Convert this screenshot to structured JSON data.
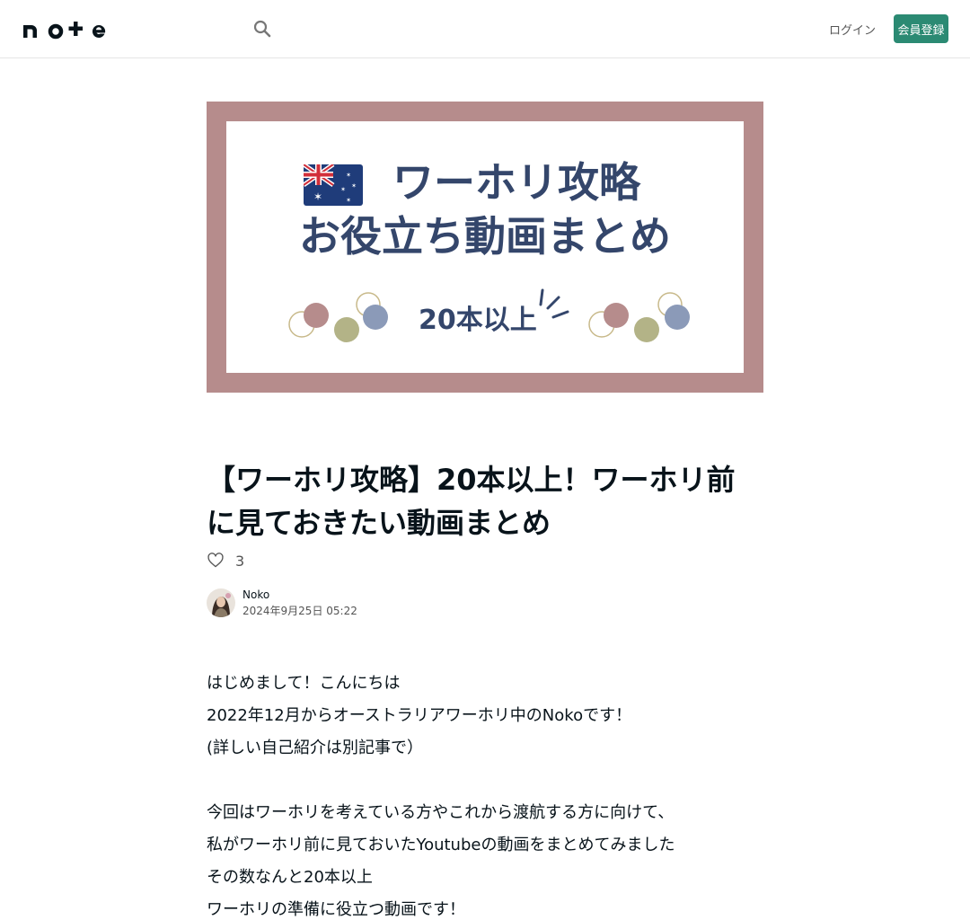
{
  "header": {
    "logo_text": "note",
    "login_label": "ログイン",
    "signup_label": "会員登録",
    "brand_color": "#2b8a73"
  },
  "hero": {
    "frame_color": "#b68c8c",
    "text_color": "#34466b",
    "line1": "ワーホリ攻略",
    "line2": "お役立ち動画まとめ",
    "count": "20本以上"
  },
  "article": {
    "title": "【ワーホリ攻略】20本以上！ワーホリ前に見ておきたい動画まとめ",
    "likes": "3",
    "author": "Noko",
    "date": "2024年9月25日 05:22",
    "body": [
      "はじめまして！こんにちは",
      "2022年12月からオーストラリアワーホリ中のNokoです！",
      "(詳しい自己紹介は別記事で）",
      "",
      "今回はワーホリを考えている方やこれから渡航する方に向けて、",
      "私がワーホリ前に見ておいたYoutubeの動画をまとめてみました",
      "その数なんと20本以上",
      "ワーホリの準備に役立つ動画です！"
    ]
  },
  "icons": {
    "search": "search-icon",
    "like": "heart-icon",
    "flag": "australia-flag-icon"
  }
}
